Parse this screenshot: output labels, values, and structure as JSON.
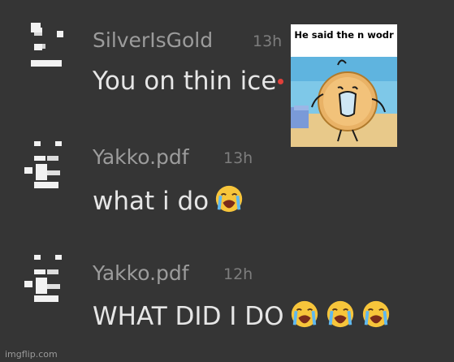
{
  "messages": [
    {
      "username": "SilverIsGold",
      "time": "13h",
      "text": "You on thin ice",
      "emoji_count": 0
    },
    {
      "username": "Yakko.pdf",
      "time": "13h",
      "text": "what i do",
      "emoji_count": 1
    },
    {
      "username": "Yakko.pdf",
      "time": "12h",
      "text": "WHAT DID I DO",
      "emoji_count": 3
    }
  ],
  "meme": {
    "caption": "He said the n wodr"
  },
  "watermark": "imgflip.com",
  "icons": {
    "emoji": "loudly-crying-face-icon",
    "avatar": "pixel-avatar-icon"
  },
  "colors": {
    "background": "#353535",
    "username": "#9c9c9c",
    "message_text": "#e6e6e6",
    "timestamp": "#7d7d7d"
  }
}
